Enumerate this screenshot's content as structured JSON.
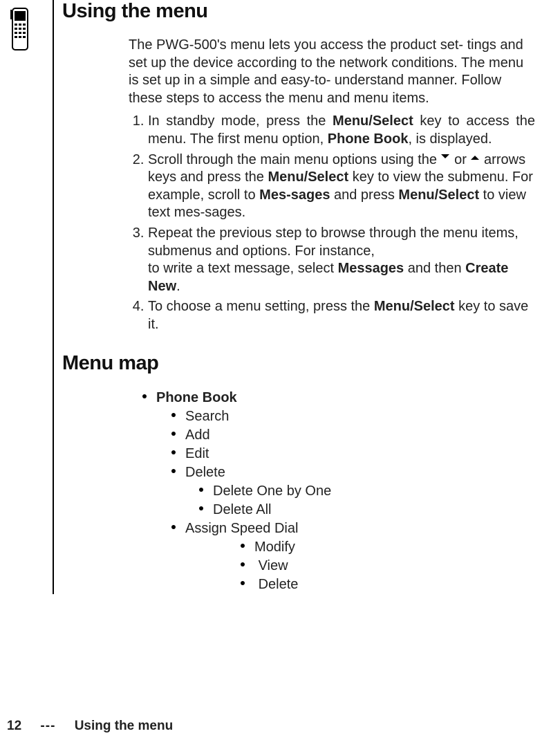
{
  "header1": "Using the menu",
  "intro_parts": {
    "a": "The PWG-500's menu lets you access the product set- tings and set up the device according to the network conditions. The menu is set up in a simple and easy-to- understand manner. Follow these steps to access the menu and menu items."
  },
  "steps": {
    "s1": {
      "p1": "In standby mode, press the ",
      "b1": "Menu/Select",
      "p2": " key to access the menu. The first menu option, ",
      "b2": "Phone Book",
      "p3": ", is displayed."
    },
    "s2": {
      "p1": "Scroll through the main menu options using the ",
      "arrow1": "down",
      "p2": " or ",
      "arrow2": "up",
      "p3": " arrows keys and press the ",
      "b1": "Menu/Select",
      "p4": " key to view the submenu. For example, scroll to ",
      "b2": "Mes-sages",
      "p5": " and press ",
      "b3": "Menu/Select",
      "p6": " to view text mes-sages."
    },
    "s3": {
      "p1": "Repeat the previous step to browse through the menu items, submenus and options. For instance,",
      "p2": "to write a text message, select ",
      "b1": "Messages",
      "p3": " and then ",
      "b2": "Create New",
      "p4": "."
    },
    "s4": {
      "p1": "To choose a menu setting, press the ",
      "b1": "Menu/Select",
      "p2": " key to save it."
    }
  },
  "header2": "Menu map",
  "menu": {
    "l1": "Phone Book",
    "l2a": "Search",
    "l2b": "Add",
    "l2c": "Edit",
    "l2d": "Delete",
    "l3a": "Delete One by One",
    "l3b": "Delete All",
    "l2e": "Assign Speed Dial",
    "l3c": "Modify",
    "l3d": "View",
    "l3e": "Delete"
  },
  "footer": {
    "page": "12",
    "dash": "---",
    "title": "Using the menu"
  }
}
